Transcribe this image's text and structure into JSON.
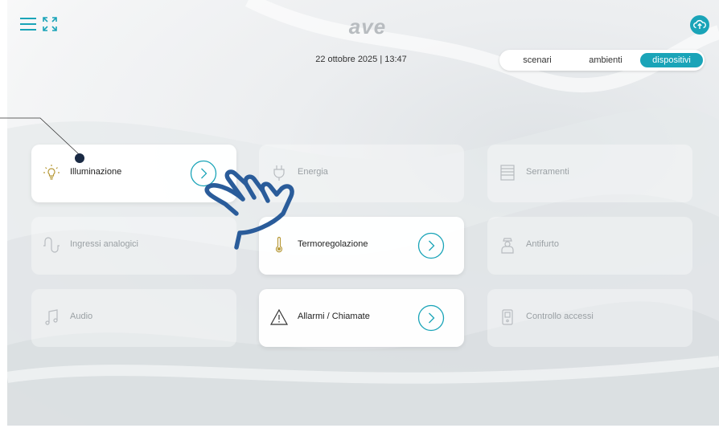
{
  "app": {
    "logo_text": "ave"
  },
  "header": {
    "datetime": "22 ottobre 2025 | 13:47"
  },
  "tabs": [
    {
      "label": "scenari",
      "active": false
    },
    {
      "label": "ambienti",
      "active": false
    },
    {
      "label": "dispositivi",
      "active": true
    }
  ],
  "devices": [
    {
      "label": "Illuminazione",
      "icon": "bulb-icon",
      "active": true
    },
    {
      "label": "Energia",
      "icon": "plug-icon",
      "active": false
    },
    {
      "label": "Serramenti",
      "icon": "shutter-icon",
      "active": false
    },
    {
      "label": "Ingressi analogici",
      "icon": "wave-icon",
      "active": false
    },
    {
      "label": "Termoregolazione",
      "icon": "thermometer-icon",
      "active": true
    },
    {
      "label": "Antifurto",
      "icon": "guard-icon",
      "active": false
    },
    {
      "label": "Audio",
      "icon": "music-icon",
      "active": false
    },
    {
      "label": "Allarmi / Chiamate",
      "icon": "warning-icon",
      "active": true
    },
    {
      "label": "Controllo accessi",
      "icon": "door-phone-icon",
      "active": false
    }
  ],
  "colors": {
    "accent": "#1aa4b8",
    "active_tile": "#ffffff",
    "inactive_text": "#9aa0a4",
    "hand": "#2a5c9a"
  }
}
